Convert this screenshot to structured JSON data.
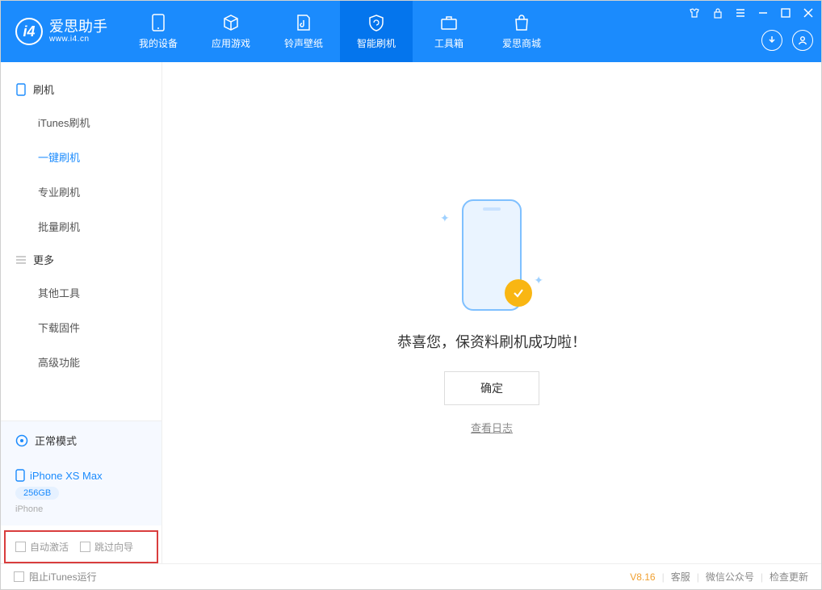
{
  "app": {
    "title": "爱思助手",
    "subtitle": "www.i4.cn"
  },
  "tabs": {
    "device": "我的设备",
    "apps": "应用游戏",
    "ring": "铃声壁纸",
    "flash": "智能刷机",
    "toolbox": "工具箱",
    "store": "爱思商城"
  },
  "sidebar": {
    "group_flash": "刷机",
    "items_flash": {
      "itunes": "iTunes刷机",
      "onekey": "一键刷机",
      "pro": "专业刷机",
      "batch": "批量刷机"
    },
    "group_more": "更多",
    "items_more": {
      "other": "其他工具",
      "firmware": "下载固件",
      "advanced": "高级功能"
    },
    "mode": "正常模式",
    "device": {
      "name": "iPhone XS Max",
      "storage": "256GB",
      "type": "iPhone"
    },
    "opts": {
      "auto_activate": "自动激活",
      "skip_guide": "跳过向导"
    }
  },
  "main": {
    "message": "恭喜您，保资料刷机成功啦！",
    "ok": "确定",
    "view_log": "查看日志"
  },
  "footer": {
    "block_itunes": "阻止iTunes运行",
    "version": "V8.16",
    "support": "客服",
    "wechat": "微信公众号",
    "update": "检查更新"
  }
}
